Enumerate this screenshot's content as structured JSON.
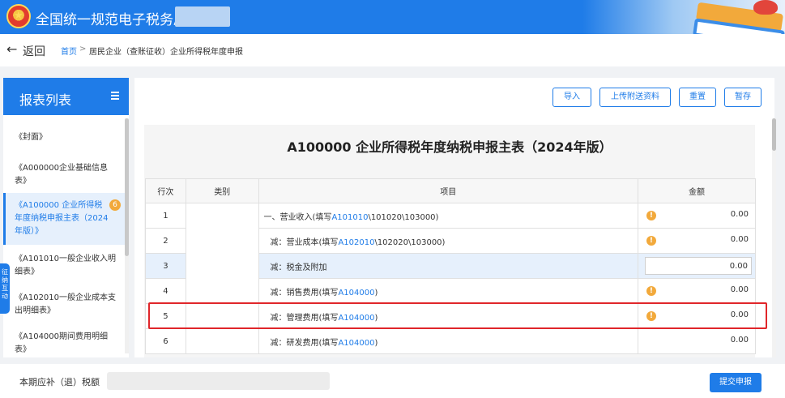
{
  "header": {
    "app_title": "全国统一规范电子税务局",
    "logo_icon": "tax-emblem-icon"
  },
  "breadcrumb": {
    "back_label": "返回",
    "home": "首页",
    "separator": ">",
    "current": "居民企业（查账征收）企业所得税年度申报"
  },
  "sidebar": {
    "title": "报表列表",
    "items": [
      {
        "label": "《封面》"
      },
      {
        "label": "《A000000企业基础信息表》"
      },
      {
        "label": "《A100000 企业所得税年度纳税申报主表（2024年版）》",
        "badge": "6"
      },
      {
        "label": "《A101010一般企业收入明细表》"
      },
      {
        "label": "《A102010一般企业成本支出明细表》"
      },
      {
        "label": "《A104000期间费用明细表》"
      }
    ],
    "float_tab": "征纳互动"
  },
  "toolbar": {
    "import": "导入",
    "upload": "上传附送资料",
    "reset": "重置",
    "save": "暂存"
  },
  "form": {
    "title": "A100000 企业所得税年度纳税申报主表（2024年版）",
    "columns": [
      "行次",
      "类别",
      "项目",
      "金额"
    ],
    "rows": [
      {
        "row": "1",
        "prefix": "一、营业收入(填写",
        "link": "A101010",
        "suffix": "\\101020\\103000)",
        "amount": "0.00",
        "warn": true
      },
      {
        "row": "2",
        "prefix": "减：营业成本(填写",
        "link": "A102010",
        "suffix": "\\102020\\103000)",
        "amount": "0.00",
        "warn": true
      },
      {
        "row": "3",
        "prefix": "减：税金及附加",
        "link": "",
        "suffix": "",
        "amount": "0.00",
        "warn": false,
        "editable": true
      },
      {
        "row": "4",
        "prefix": "减：销售费用(填写",
        "link": "A104000",
        "suffix": ")",
        "amount": "0.00",
        "warn": true
      },
      {
        "row": "5",
        "prefix": "减：管理费用(填写",
        "link": "A104000",
        "suffix": ")",
        "amount": "0.00",
        "warn": true
      },
      {
        "row": "6",
        "prefix": "减：研发费用(填写",
        "link": "A104000",
        "suffix": ")",
        "amount": "0.00",
        "warn": false
      }
    ]
  },
  "footer": {
    "due_label": "本期应补（退）税额",
    "submit": "提交申报"
  },
  "colors": {
    "primary": "#1f7ce8",
    "warning": "#f2a93b",
    "highlight_box": "#e0262a"
  }
}
